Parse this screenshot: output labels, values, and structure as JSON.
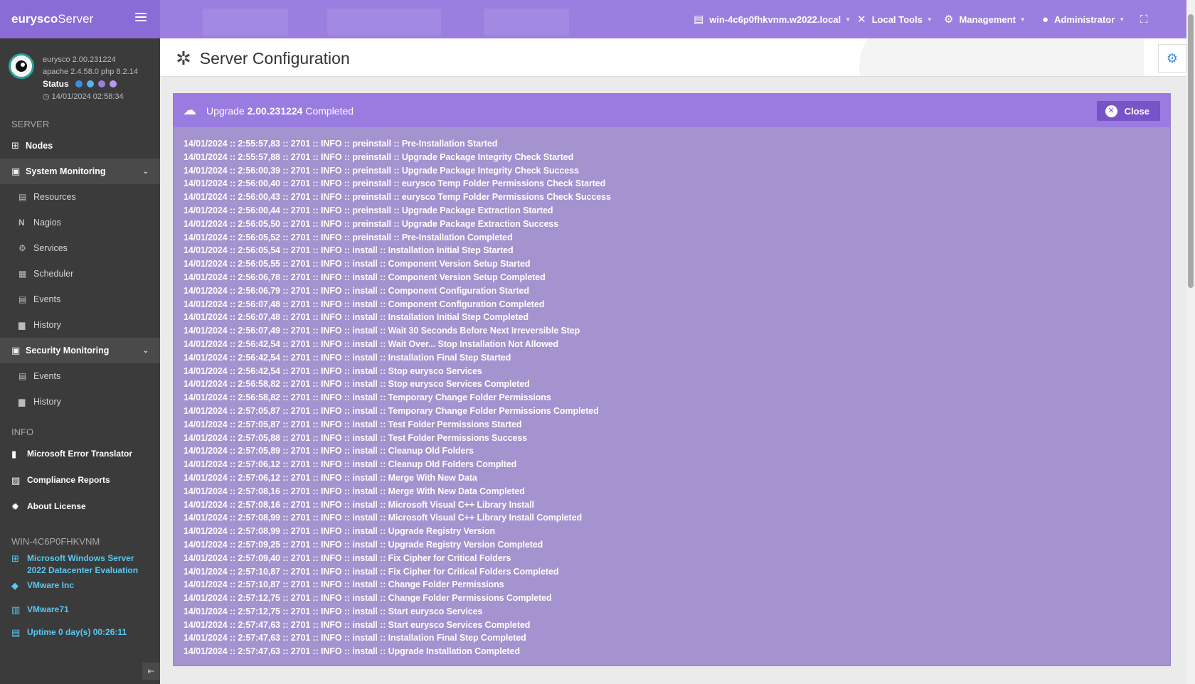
{
  "brand": {
    "name_bold": "eurysco",
    "name_rest": "Server"
  },
  "topnav": [
    {
      "label": "win-4c6p0fhkvnm.w2022.local",
      "icon": "server-icon"
    },
    {
      "label": "Local Tools",
      "icon": "tools-icon"
    },
    {
      "label": "Management",
      "icon": "cogs-icon"
    },
    {
      "label": "Administrator",
      "icon": "user-icon"
    }
  ],
  "profile": {
    "version": "eurysco 2.00.231224",
    "stack": "apache 2.4.58.0  php 8.2.14",
    "status_label": "Status",
    "timestamp": "14/01/2024 02:58:34"
  },
  "sidebar": {
    "server_header": "SERVER",
    "nodes": "Nodes",
    "system_monitoring": "System Monitoring",
    "sys_items": [
      "Resources",
      "Nagios",
      "Services",
      "Scheduler",
      "Events",
      "History"
    ],
    "security_monitoring": "Security Monitoring",
    "sec_items": [
      "Events",
      "History"
    ],
    "info_header": "INFO",
    "info_items": [
      "Microsoft Error Translator",
      "Compliance Reports",
      "About License"
    ],
    "host_header": "WIN-4C6P0FHKVNM",
    "host_items": [
      "Microsoft Windows Server 2022 Datacenter Evaluation",
      "VMware Inc",
      "VMware71",
      "Uptime 0 day(s) 00:26:11"
    ]
  },
  "page": {
    "title": "Server Configuration"
  },
  "panel": {
    "title_prefix": "Upgrade",
    "title_version": "2.00.231224",
    "title_suffix": "Completed",
    "close_label": "Close"
  },
  "log": [
    "14/01/2024 :: 2:55:57,83 :: 2701 :: INFO :: preinstall :: Pre-Installation Started",
    "14/01/2024 :: 2:55:57,88 :: 2701 :: INFO :: preinstall :: Upgrade Package Integrity Check Started",
    "14/01/2024 :: 2:56:00,39 :: 2701 :: INFO :: preinstall :: Upgrade Package Integrity Check Success",
    "14/01/2024 :: 2:56:00,40 :: 2701 :: INFO :: preinstall :: eurysco Temp Folder Permissions Check Started",
    "14/01/2024 :: 2:56:00,43 :: 2701 :: INFO :: preinstall :: eurysco Temp Folder Permissions Check Success",
    "14/01/2024 :: 2:56:00,44 :: 2701 :: INFO :: preinstall :: Upgrade Package Extraction Started",
    "14/01/2024 :: 2:56:05,50 :: 2701 :: INFO :: preinstall :: Upgrade Package Extraction Success",
    "14/01/2024 :: 2:56:05,52 :: 2701 :: INFO :: preinstall :: Pre-Installation Completed",
    "14/01/2024 :: 2:56:05,54 :: 2701 :: INFO :: install :: Installation Initial Step Started",
    "14/01/2024 :: 2:56:05,55 :: 2701 :: INFO :: install :: Component Version Setup Started",
    "14/01/2024 :: 2:56:06,78 :: 2701 :: INFO :: install :: Component Version Setup Completed",
    "14/01/2024 :: 2:56:06,79 :: 2701 :: INFO :: install :: Component Configuration Started",
    "14/01/2024 :: 2:56:07,48 :: 2701 :: INFO :: install :: Component Configuration Completed",
    "14/01/2024 :: 2:56:07,48 :: 2701 :: INFO :: install :: Installation Initial Step Completed",
    "14/01/2024 :: 2:56:07,49 :: 2701 :: INFO :: install :: Wait 30 Seconds Before Next Irreversible Step",
    "14/01/2024 :: 2:56:42,54 :: 2701 :: INFO :: install :: Wait Over... Stop Installation Not Allowed",
    "14/01/2024 :: 2:56:42,54 :: 2701 :: INFO :: install :: Installation Final Step Started",
    "14/01/2024 :: 2:56:42,54 :: 2701 :: INFO :: install :: Stop eurysco Services",
    "14/01/2024 :: 2:56:58,82 :: 2701 :: INFO :: install :: Stop eurysco Services Completed",
    "14/01/2024 :: 2:56:58,82 :: 2701 :: INFO :: install :: Temporary Change Folder Permissions",
    "14/01/2024 :: 2:57:05,87 :: 2701 :: INFO :: install :: Temporary Change Folder Permissions Completed",
    "14/01/2024 :: 2:57:05,87 :: 2701 :: INFO :: install :: Test Folder Permissions Started",
    "14/01/2024 :: 2:57:05,88 :: 2701 :: INFO :: install :: Test Folder Permissions Success",
    "14/01/2024 :: 2:57:05,89 :: 2701 :: INFO :: install :: Cleanup Old Folders",
    "14/01/2024 :: 2:57:06,12 :: 2701 :: INFO :: install :: Cleanup Old Folders Complted",
    "14/01/2024 :: 2:57:06,12 :: 2701 :: INFO :: install :: Merge With New Data",
    "14/01/2024 :: 2:57:08,16 :: 2701 :: INFO :: install :: Merge With New Data Completed",
    "14/01/2024 :: 2:57:08,16 :: 2701 :: INFO :: install :: Microsoft Visual C++ Library Install",
    "14/01/2024 :: 2:57:08,99 :: 2701 :: INFO :: install :: Microsoft Visual C++ Library Install Completed",
    "14/01/2024 :: 2:57:08,99 :: 2701 :: INFO :: install :: Upgrade Registry Version",
    "14/01/2024 :: 2:57:09,25 :: 2701 :: INFO :: install :: Upgrade Registry Version Completed",
    "14/01/2024 :: 2:57:09,40 :: 2701 :: INFO :: install :: Fix Cipher for Critical Folders",
    "14/01/2024 :: 2:57:10,87 :: 2701 :: INFO :: install :: Fix Cipher for Critical Folders Completed",
    "14/01/2024 :: 2:57:10,87 :: 2701 :: INFO :: install :: Change Folder Permissions",
    "14/01/2024 :: 2:57:12,75 :: 2701 :: INFO :: install :: Change Folder Permissions Completed",
    "14/01/2024 :: 2:57:12,75 :: 2701 :: INFO :: install :: Start eurysco Services",
    "14/01/2024 :: 2:57:47,63 :: 2701 :: INFO :: install :: Start eurysco Services Completed",
    "14/01/2024 :: 2:57:47,63 :: 2701 :: INFO :: install :: Installation Final Step Completed",
    "14/01/2024 :: 2:57:47,63 :: 2701 :: INFO :: install :: Upgrade Installation Completed"
  ],
  "colors": {
    "accent": "#9b7fe0",
    "sidebar": "#3b3b3b",
    "link_blue": "#5ac8f0",
    "close_btn": "#7754c8"
  }
}
